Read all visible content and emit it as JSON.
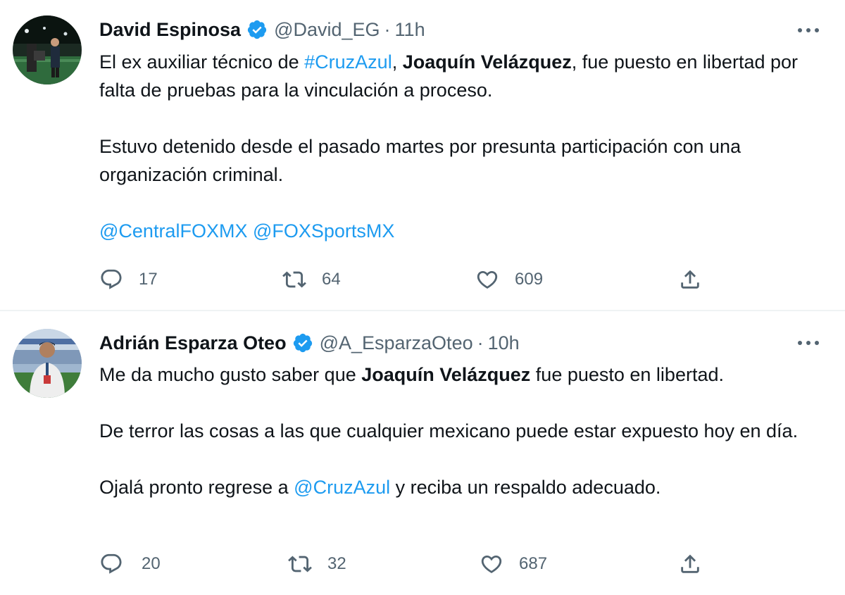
{
  "tweets": [
    {
      "author": {
        "name": "David Espinosa",
        "handle": "@David_EG",
        "verified": true,
        "avatar_icon": "avatar-photo"
      },
      "time": "11h",
      "separator": "·",
      "paragraphs": [
        [
          {
            "text": "El ex auxiliar técnico de ",
            "style": "normal"
          },
          {
            "text": "#CruzAzul",
            "style": "link"
          },
          {
            "text": ", ",
            "style": "normal"
          },
          {
            "text": "Joaquín Velázquez",
            "style": "bold"
          },
          {
            "text": ", fue puesto en libertad por falta de pruebas para la vinculación a proceso.",
            "style": "normal"
          }
        ],
        [
          {
            "text": "Estuvo detenido desde el pasado martes por presunta participación con una organización criminal.",
            "style": "normal"
          }
        ],
        [
          {
            "text": "@CentralFOXMX",
            "style": "link"
          },
          {
            "text": " ",
            "style": "normal"
          },
          {
            "text": "@FOXSportsMX",
            "style": "link"
          }
        ]
      ],
      "stats": {
        "replies": "17",
        "retweets": "64",
        "likes": "609"
      },
      "more_icon": "more-horizontal-icon"
    },
    {
      "author": {
        "name": "Adrián Esparza Oteo",
        "handle": "@A_EsparzaOteo",
        "verified": true,
        "avatar_icon": "avatar-photo"
      },
      "time": "10h",
      "separator": "·",
      "paragraphs": [
        [
          {
            "text": "Me da mucho gusto saber que ",
            "style": "normal"
          },
          {
            "text": "Joaquín Velázquez",
            "style": "bold"
          },
          {
            "text": " fue puesto en libertad.",
            "style": "normal"
          }
        ],
        [
          {
            "text": "De terror las cosas a las que cualquier mexicano puede estar expuesto hoy en día.",
            "style": "normal"
          }
        ],
        [
          {
            "text": "Ojalá pronto regrese a ",
            "style": "normal"
          },
          {
            "text": "@CruzAzul",
            "style": "link"
          },
          {
            "text": " y reciba un respaldo adecuado.",
            "style": "normal"
          }
        ]
      ],
      "stats": {
        "replies": "20",
        "retweets": "32",
        "likes": "687"
      },
      "more_icon": "more-horizontal-icon"
    }
  ],
  "colors": {
    "link": "#1d9bf0",
    "verified": "#1d9bf0",
    "muted": "#536471",
    "text": "#0f1419",
    "divider": "#eff3f4"
  },
  "icons": {
    "reply": "reply-icon",
    "retweet": "retweet-icon",
    "like": "like-icon",
    "share": "share-icon",
    "verified": "verified-badge-icon"
  }
}
